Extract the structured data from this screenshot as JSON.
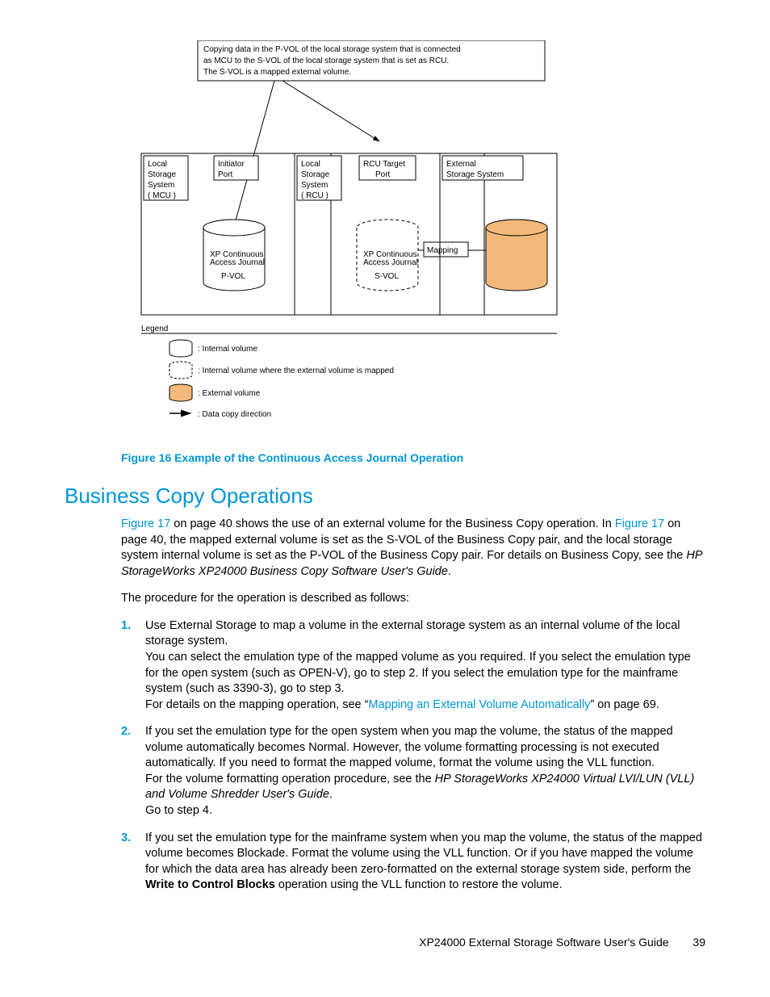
{
  "diagram": {
    "copy_note_l1": "Copying data in the P-VOL of the local storage system that is connected",
    "copy_note_l2": "as MCU to the S-VOL of the local storage system that is set as RCU.",
    "copy_note_l3": "The S-VOL is a mapped external volume.",
    "mcu_l1": "Local",
    "mcu_l2": "Storage",
    "mcu_l3": "System",
    "mcu_l4": "( MCU )",
    "initiator_l1": "Initiator",
    "initiator_l2": "Port",
    "rcu_l1": "Local",
    "rcu_l2": "Storage",
    "rcu_l3": "System",
    "rcu_l4": "( RCU )",
    "rcu_target_l1": "RCU Target",
    "rcu_target_l2": "Port",
    "ext_l1": "External",
    "ext_l2": "Storage System",
    "cyl_small_1": "XP Continuous",
    "cyl_small_2": "Access Journal",
    "pvol": "P-VOL",
    "svol": "S-VOL",
    "mapping": "Mapping",
    "legend_title": "Legend",
    "legend_int": ": Internal volume",
    "legend_int_mapped": ": Internal volume where the external volume is mapped",
    "legend_ext": ": External volume",
    "legend_dir": ": Data copy direction"
  },
  "figure_caption": "Figure 16 Example of the Continuous Access Journal Operation",
  "section_heading": "Business Copy Operations",
  "intro": {
    "l1a": "Figure 17",
    "l1b": " on page 40 shows the use of an external volume for the Business Copy operation. In ",
    "l2a": "Figure 17",
    "l2b": " on page 40, the mapped external volume is set as the S-VOL of the Business Copy pair, and the local storage system internal volume is set as the P-VOL of the Business Copy pair. For details on Business Copy, see the ",
    "l2c": "HP StorageWorks XP24000 Business Copy Software User's Guide",
    "l2d": "."
  },
  "proc_lead": "The procedure for the operation is described as follows:",
  "steps": {
    "n1": "1.",
    "s1a": "Use External Storage to map a volume in the external storage system as an internal volume of the local storage system.",
    "s1b": "You can select the emulation type of the mapped volume as you required. If you select the emulation type for the open system (such as OPEN-V), go to step 2. If you select the emulation type for the mainframe system (such as 3390-3), go to step 3.",
    "s1c": "For details on the mapping operation, see “",
    "s1link": "Mapping an External Volume Automatically",
    "s1d": "” on page 69.",
    "n2": "2.",
    "s2a": "If you set the emulation type for the open system when you map the volume, the status of the mapped volume automatically becomes Normal. However, the volume formatting processing is not executed automatically. If you need to format the mapped volume, format the volume using the VLL function.",
    "s2b": "For the volume formatting operation procedure, see the ",
    "s2c": "HP StorageWorks XP24000 Virtual LVI/LUN (VLL) and Volume Shredder User's Guide",
    "s2d": ".",
    "s2e": "Go to step 4.",
    "n3": "3.",
    "s3a": "If you set the emulation type for the mainframe system when you map the volume, the status of the mapped volume becomes Blockade. Format the volume using the VLL function. Or if you have mapped the volume for which the data area has already been zero-formatted on the external storage system side, perform the ",
    "s3b": "Write to Control Blocks",
    "s3c": " operation using the VLL function to restore the volume."
  },
  "footer": {
    "title": "XP24000 External Storage Software User's Guide",
    "page": "39"
  }
}
